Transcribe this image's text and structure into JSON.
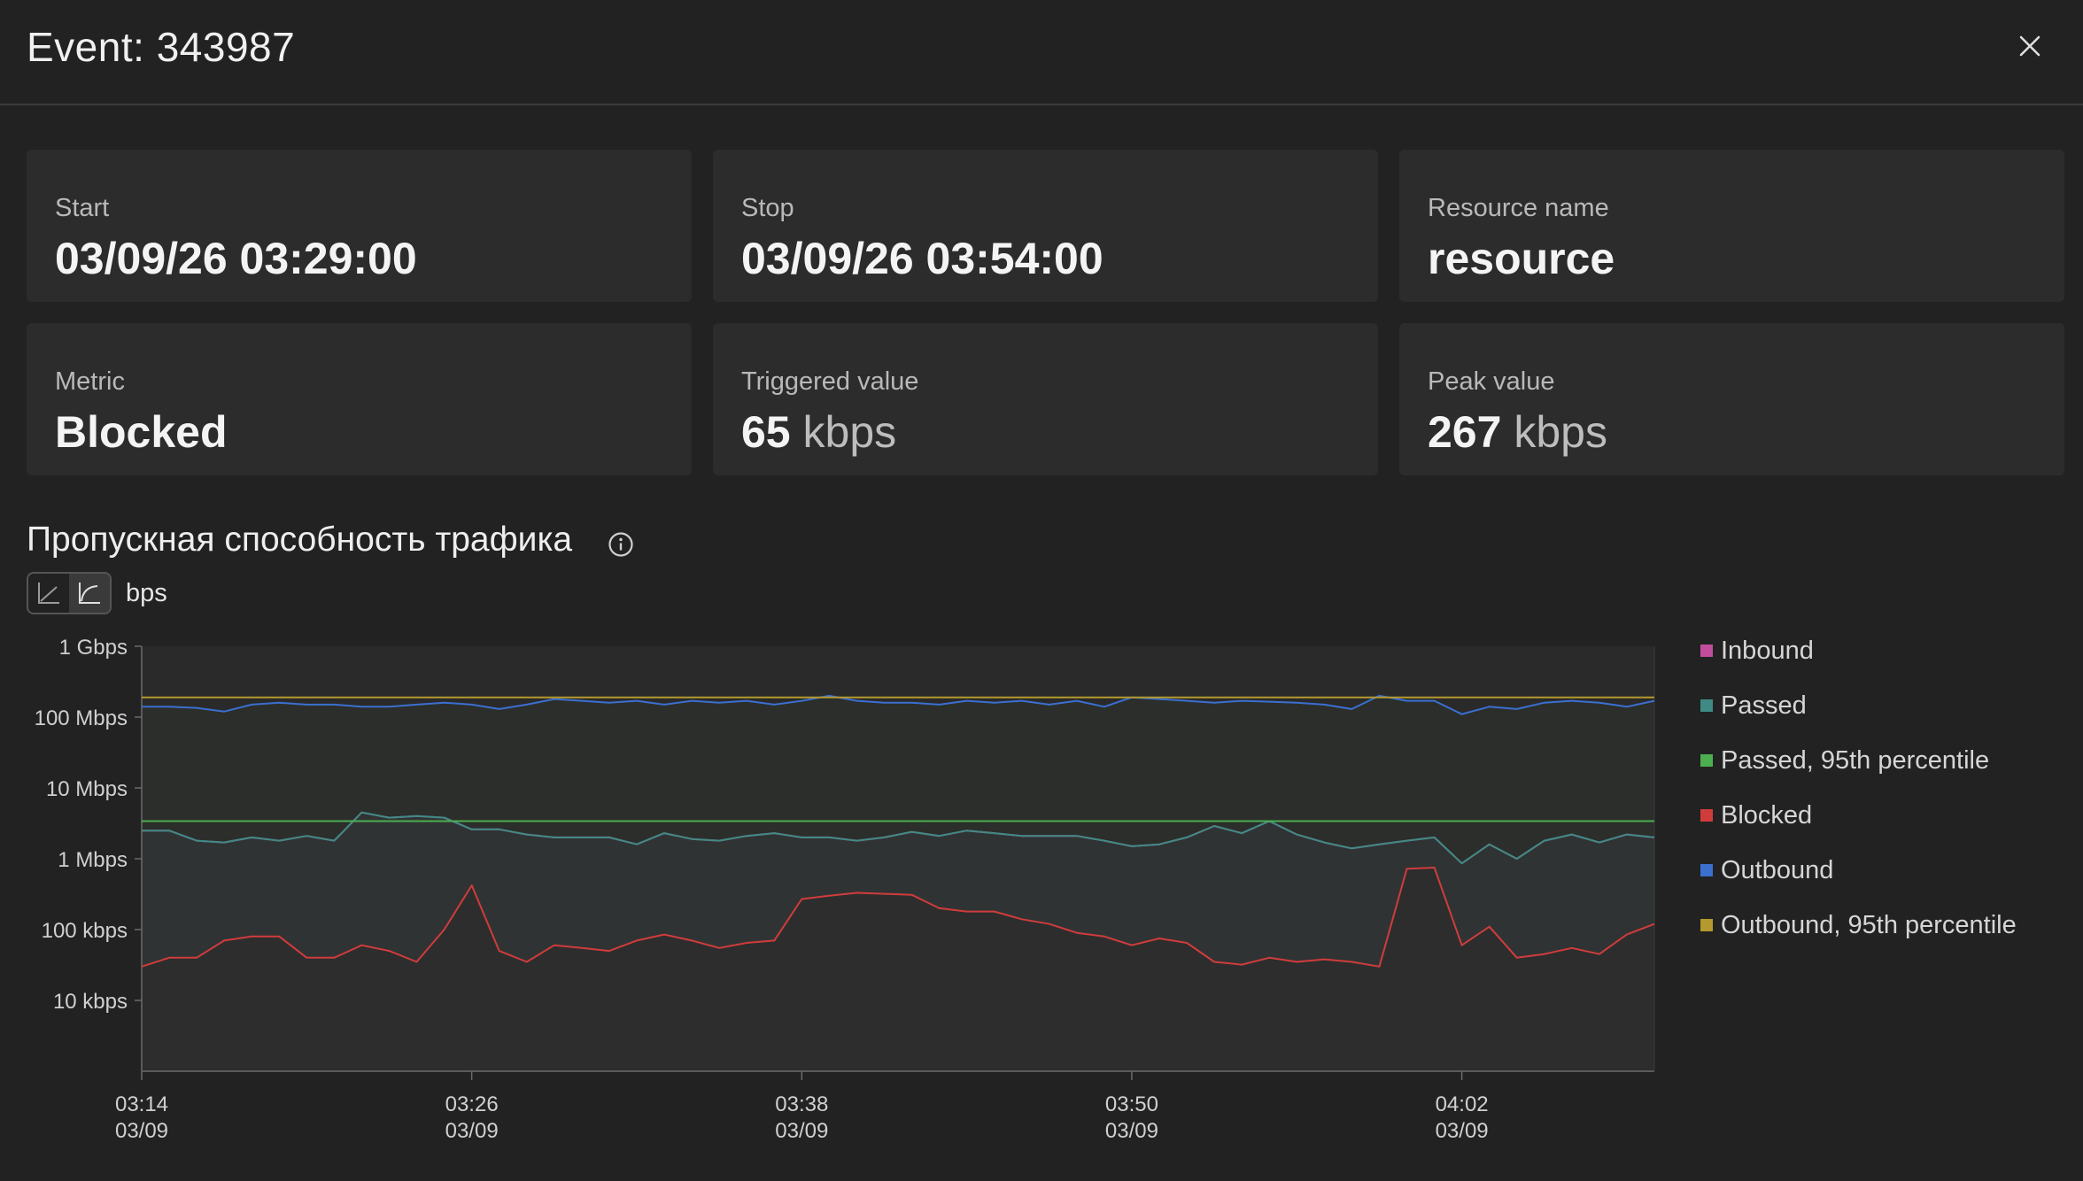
{
  "header": {
    "title": "Event: 343987",
    "close_icon": "close-icon"
  },
  "cards": [
    {
      "label": "Start",
      "value": "03/09/26 03:29:00",
      "unit": ""
    },
    {
      "label": "Stop",
      "value": "03/09/26 03:54:00",
      "unit": ""
    },
    {
      "label": "Resource name",
      "value": "resource",
      "unit": ""
    },
    {
      "label": "Metric",
      "value": "Blocked",
      "unit": ""
    },
    {
      "label": "Triggered value",
      "value": "65",
      "unit": "kbps"
    },
    {
      "label": "Peak value",
      "value": "267",
      "unit": "kbps"
    }
  ],
  "section": {
    "title": "Пропускная способность трафика",
    "info_icon": "info-icon",
    "unit": "bps",
    "toggle": [
      "linear-scale-icon",
      "log-scale-icon"
    ],
    "active_toggle": 1
  },
  "colors": {
    "inbound": "#c14d9c",
    "passed": "#3f8a85",
    "passed_p95": "#4caf50",
    "blocked": "#d03c3c",
    "outbound": "#3b6fd0",
    "outbound_p95": "#b49a2e"
  },
  "chart_data": {
    "type": "line",
    "yscale": "log",
    "ylim_bps": [
      1000,
      1000000000
    ],
    "ytick_values": [
      1000000000,
      100000000,
      10000000,
      1000000,
      100000,
      10000
    ],
    "ytick_labels": [
      "1 Gbps",
      "100 Mbps",
      "10 Mbps",
      "1 Mbps",
      "100 kbps",
      "10 kbps"
    ],
    "x_range": [
      "03:14",
      "04:09"
    ],
    "xtick_labels": [
      [
        "03:14",
        "03/09"
      ],
      [
        "03:26",
        "03/09"
      ],
      [
        "03:38",
        "03/09"
      ],
      [
        "03:50",
        "03/09"
      ],
      [
        "04:02",
        "03/09"
      ]
    ],
    "x": [
      "03:14",
      "03:15",
      "03:16",
      "03:17",
      "03:18",
      "03:19",
      "03:20",
      "03:21",
      "03:22",
      "03:23",
      "03:24",
      "03:25",
      "03:26",
      "03:27",
      "03:28",
      "03:29",
      "03:30",
      "03:31",
      "03:32",
      "03:33",
      "03:34",
      "03:35",
      "03:36",
      "03:37",
      "03:38",
      "03:39",
      "03:40",
      "03:41",
      "03:42",
      "03:43",
      "03:44",
      "03:45",
      "03:46",
      "03:47",
      "03:48",
      "03:49",
      "03:50",
      "03:51",
      "03:52",
      "03:53",
      "03:54",
      "03:55",
      "03:56",
      "03:57",
      "03:58",
      "03:59",
      "04:00",
      "04:01",
      "04:02",
      "04:03",
      "04:04",
      "04:05",
      "04:06",
      "04:07",
      "04:08",
      "04:09"
    ],
    "legend_position": "right",
    "series": [
      {
        "name": "Inbound",
        "color": "#c14d9c",
        "values": [
          2500000,
          2500000,
          1800000,
          1700000,
          2000000,
          1800000,
          2100000,
          1800000,
          4500000,
          3800000,
          4000000,
          3800000,
          2600000,
          2600000,
          2200000,
          2000000,
          2000000,
          2000000,
          1600000,
          2300000,
          1900000,
          1800000,
          2100000,
          2300000,
          2000000,
          2000000,
          1800000,
          2000000,
          2400000,
          2100000,
          2500000,
          2300000,
          2100000,
          2100000,
          2100000,
          1800000,
          1500000,
          1600000,
          2000000,
          2900000,
          2300000,
          3400000,
          2200000,
          1700000,
          1400000,
          1600000,
          1800000,
          2000000,
          860000,
          1600000,
          1000000,
          1800000,
          2200000,
          1700000,
          2200000,
          2000000
        ]
      },
      {
        "name": "Passed",
        "color": "#3f8a85",
        "values": [
          2500000,
          2500000,
          1800000,
          1700000,
          2000000,
          1800000,
          2100000,
          1800000,
          4500000,
          3800000,
          4000000,
          3800000,
          2600000,
          2600000,
          2200000,
          2000000,
          2000000,
          2000000,
          1600000,
          2300000,
          1900000,
          1800000,
          2100000,
          2300000,
          2000000,
          2000000,
          1800000,
          2000000,
          2400000,
          2100000,
          2500000,
          2300000,
          2100000,
          2100000,
          2100000,
          1800000,
          1500000,
          1600000,
          2000000,
          2900000,
          2300000,
          3400000,
          2200000,
          1700000,
          1400000,
          1600000,
          1800000,
          2000000,
          860000,
          1600000,
          1000000,
          1800000,
          2200000,
          1700000,
          2200000,
          2000000
        ]
      },
      {
        "name": "Passed, 95th percentile",
        "color": "#4caf50",
        "values": [
          3400000,
          3400000
        ]
      },
      {
        "name": "Blocked",
        "color": "#d03c3c",
        "values": [
          30000,
          40000,
          40000,
          70000,
          80000,
          80000,
          40000,
          40000,
          60000,
          50000,
          35000,
          100000,
          420000,
          50000,
          35000,
          60000,
          55000,
          50000,
          70000,
          85000,
          70000,
          55000,
          65000,
          70000,
          270000,
          300000,
          330000,
          320000,
          310000,
          200000,
          180000,
          180000,
          140000,
          120000,
          90000,
          80000,
          60000,
          75000,
          65000,
          35000,
          32000,
          40000,
          35000,
          38000,
          35000,
          30000,
          720000,
          750000,
          60000,
          110000,
          40000,
          45000,
          55000,
          45000,
          85000,
          120000
        ]
      },
      {
        "name": "Outbound",
        "color": "#3b6fd0",
        "values": [
          140000000,
          140000000,
          135000000,
          120000000,
          150000000,
          160000000,
          150000000,
          150000000,
          140000000,
          140000000,
          150000000,
          160000000,
          150000000,
          130000000,
          150000000,
          180000000,
          170000000,
          160000000,
          170000000,
          150000000,
          170000000,
          160000000,
          170000000,
          150000000,
          170000000,
          200000000,
          170000000,
          160000000,
          160000000,
          150000000,
          170000000,
          160000000,
          170000000,
          150000000,
          170000000,
          140000000,
          190000000,
          180000000,
          170000000,
          160000000,
          170000000,
          165000000,
          160000000,
          150000000,
          130000000,
          200000000,
          170000000,
          170000000,
          110000000,
          140000000,
          130000000,
          160000000,
          170000000,
          160000000,
          140000000,
          170000000
        ]
      },
      {
        "name": "Outbound, 95th percentile",
        "color": "#b49a2e",
        "values": [
          190000000,
          190000000
        ]
      }
    ]
  }
}
